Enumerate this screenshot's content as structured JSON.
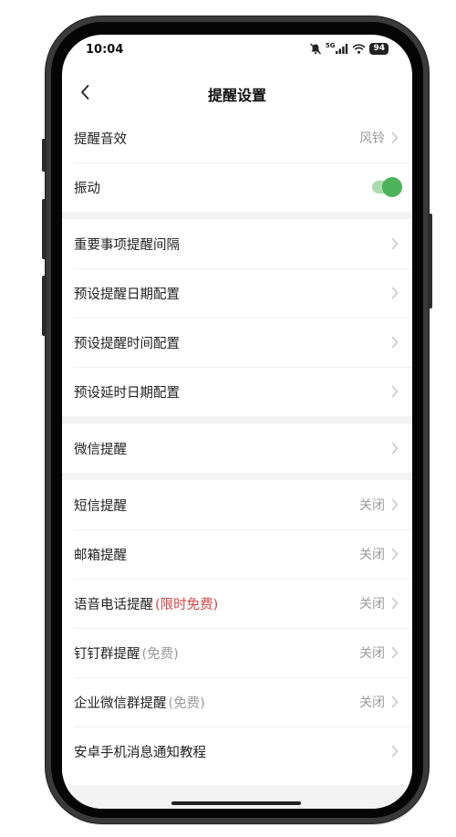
{
  "status_bar": {
    "time": "10:04",
    "network": "5G",
    "battery": "94"
  },
  "nav": {
    "title": "提醒设置"
  },
  "sections": [
    {
      "rows": [
        {
          "label": "提醒音效",
          "value": "风铃",
          "kind": "link"
        },
        {
          "label": "振动",
          "kind": "toggle",
          "toggle_on": true
        }
      ]
    },
    {
      "rows": [
        {
          "label": "重要事项提醒间隔",
          "kind": "link"
        },
        {
          "label": "预设提醒日期配置",
          "kind": "link"
        },
        {
          "label": "预设提醒时间配置",
          "kind": "link"
        },
        {
          "label": "预设延时日期配置",
          "kind": "link"
        }
      ]
    },
    {
      "rows": [
        {
          "label": "微信提醒",
          "kind": "link"
        }
      ]
    },
    {
      "rows": [
        {
          "label": "短信提醒",
          "value": "关闭",
          "kind": "link"
        },
        {
          "label": "邮箱提醒",
          "value": "关闭",
          "kind": "link"
        },
        {
          "label": "语音电话提醒",
          "extra": "(限时免费)",
          "extra_color": "red",
          "value": "关闭",
          "kind": "link"
        },
        {
          "label": "钉钉群提醒",
          "extra": "(免费)",
          "extra_color": "gray",
          "value": "关闭",
          "kind": "link"
        },
        {
          "label": "企业微信群提醒",
          "extra": "(免费)",
          "extra_color": "gray",
          "value": "关闭",
          "kind": "link"
        },
        {
          "label": "安卓手机消息通知教程",
          "kind": "link"
        }
      ]
    }
  ],
  "colors": {
    "toggle_on": "#4cb35a",
    "accent_red": "#d64545",
    "muted": "#9a9a9a",
    "section_gap": "#f3f3f3"
  }
}
